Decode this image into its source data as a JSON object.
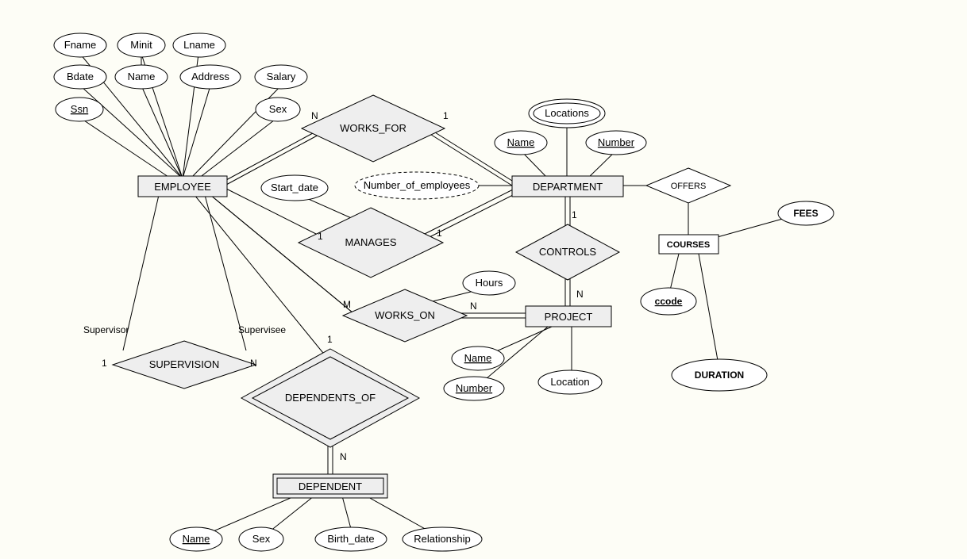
{
  "entities": {
    "employee": "EMPLOYEE",
    "department": "DEPARTMENT",
    "project": "PROJECT",
    "dependent": "DEPENDENT",
    "courses": "COURSES"
  },
  "relationships": {
    "works_for": "WORKS_FOR",
    "manages": "MANAGES",
    "controls": "CONTROLS",
    "works_on": "WORKS_ON",
    "supervision": "SUPERVISION",
    "dependents_of": "DEPENDENTS_OF",
    "offers": "OFFERS"
  },
  "attributes": {
    "fname": "Fname",
    "minit": "Minit",
    "lname": "Lname",
    "bdate": "Bdate",
    "name_emp": "Name",
    "address": "Address",
    "salary": "Salary",
    "ssn": "Ssn",
    "sex": "Sex",
    "start_date": "Start_date",
    "num_emp": "Number_of_employees",
    "locations": "Locations",
    "name_dept": "Name",
    "number_dept": "Number",
    "hours": "Hours",
    "name_proj": "Name",
    "number_proj": "Number",
    "location_proj": "Location",
    "name_dep": "Name",
    "sex_dep": "Sex",
    "birth_date": "Birth_date",
    "relationship_dep": "Relationship",
    "ccode": "ccode",
    "fees": "FEES",
    "duration": "DURATION"
  },
  "roles": {
    "supervisor": "Supervisor",
    "supervisee": "Supervisee"
  },
  "cardinalities": {
    "n": "N",
    "m": "M",
    "one": "1"
  }
}
